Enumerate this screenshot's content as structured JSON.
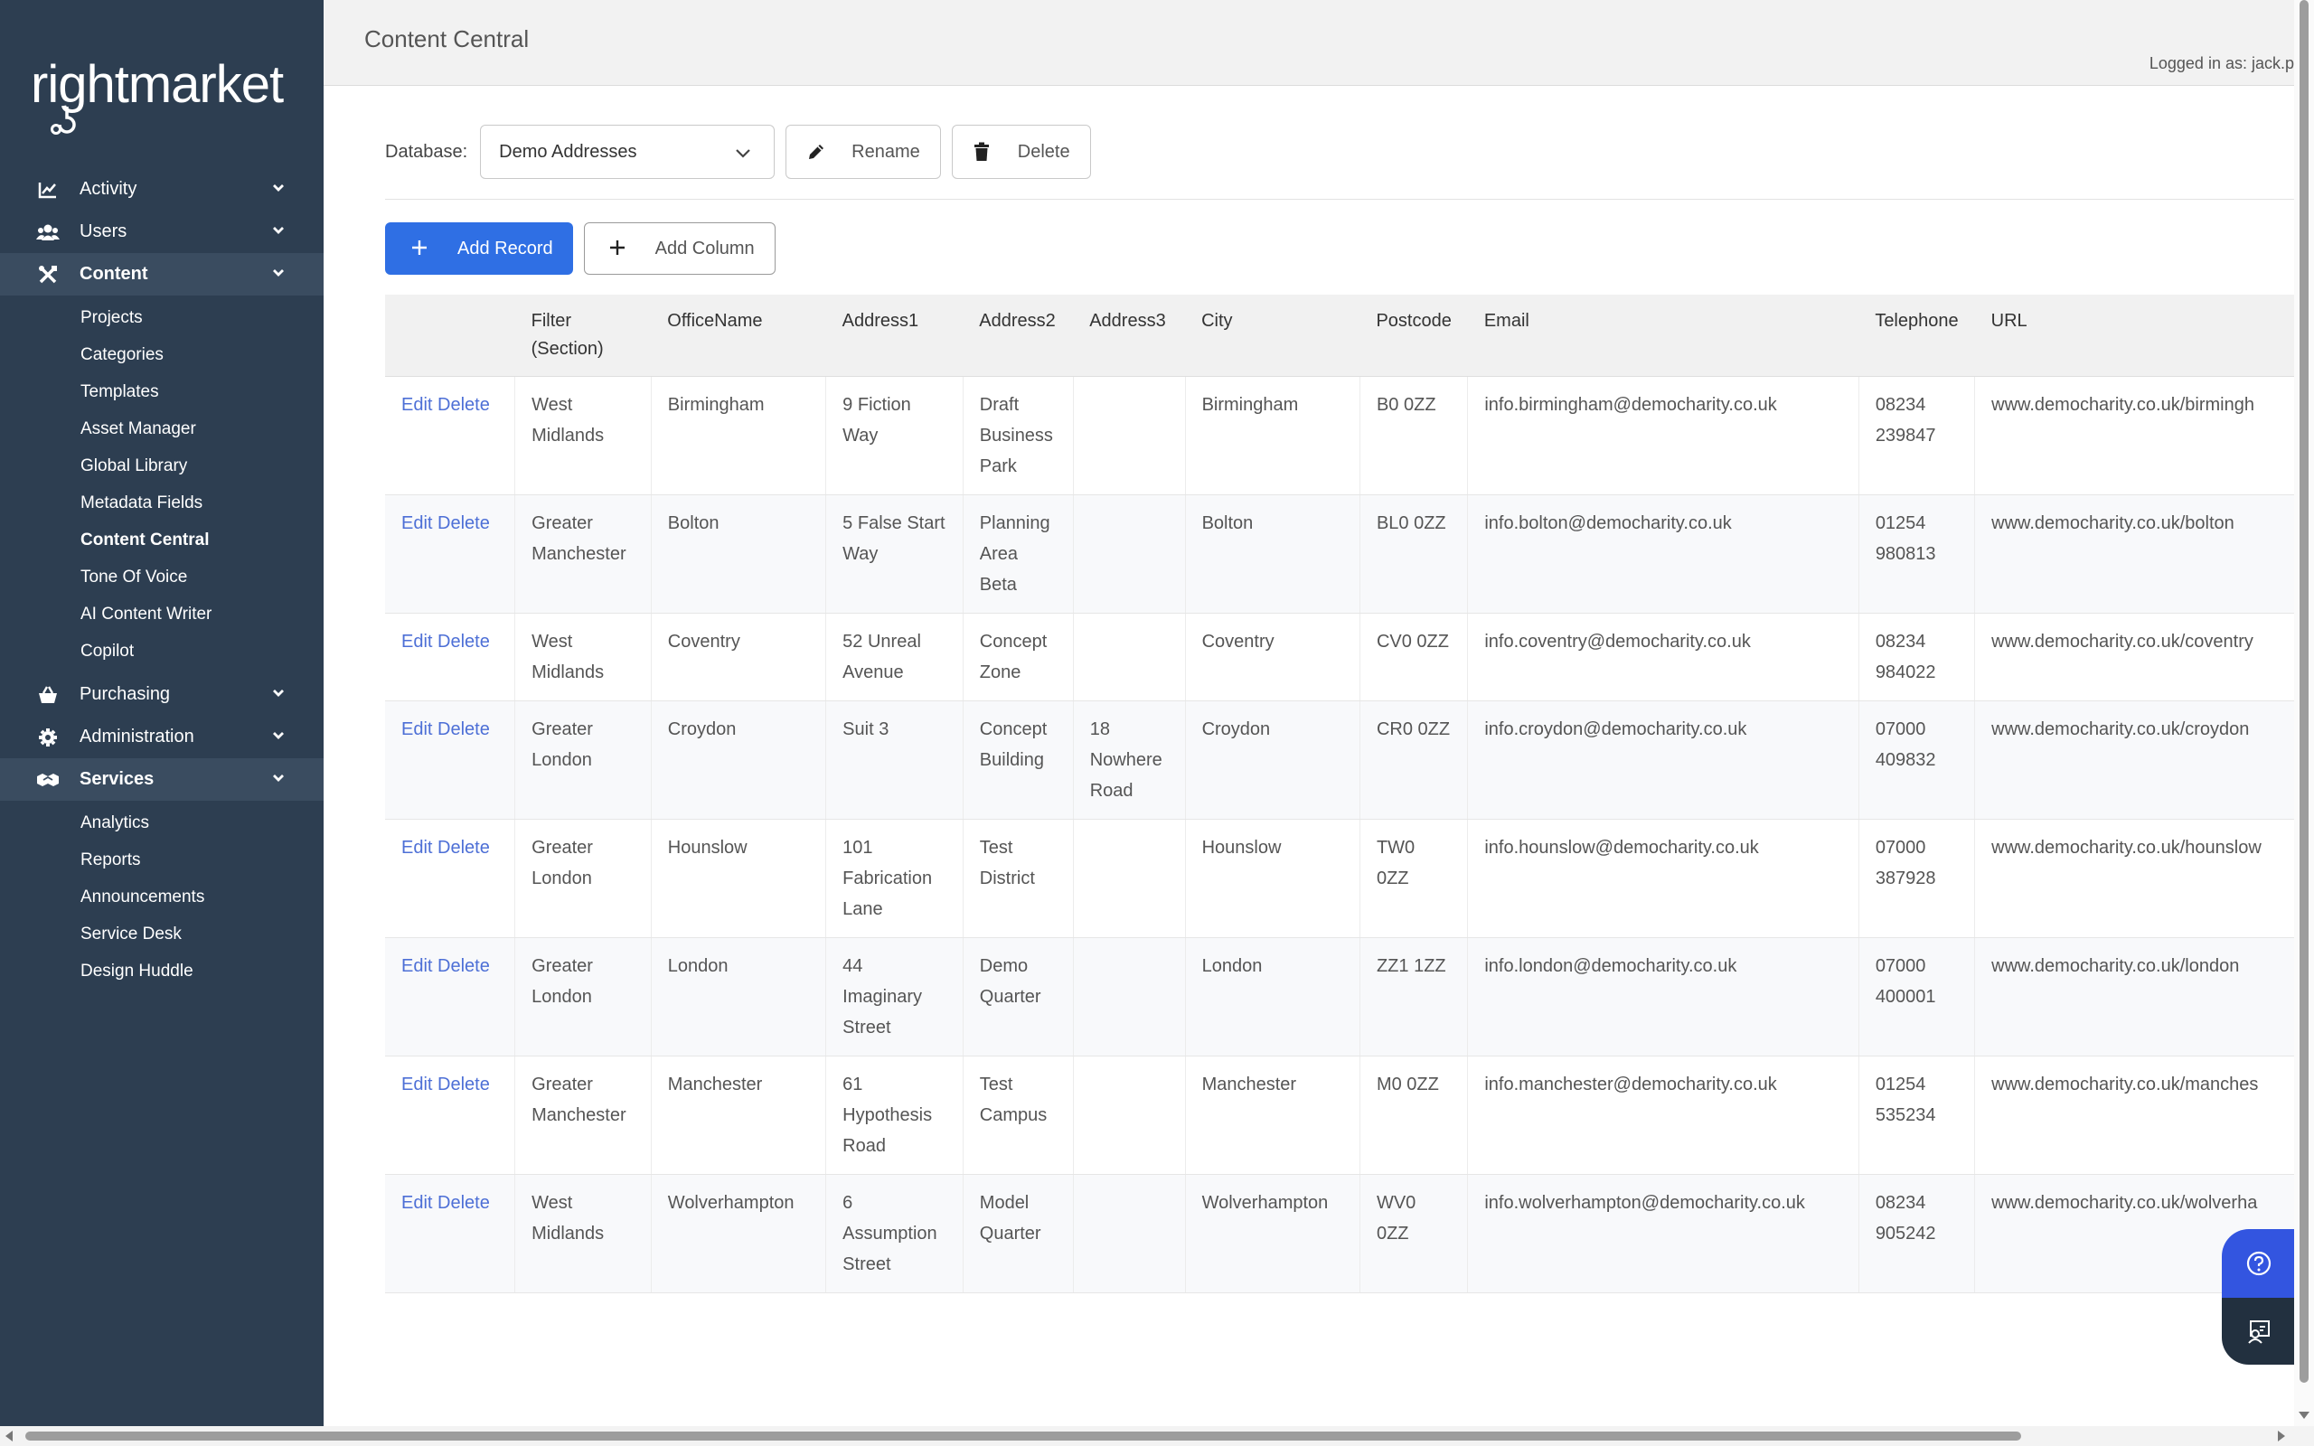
{
  "app": {
    "logo_text": "rightmarket"
  },
  "header": {
    "title": "Content Central",
    "logged_in": "Logged in as: jack.p"
  },
  "sidebar": {
    "items": [
      {
        "label": "Activity",
        "icon": "chart-line-icon"
      },
      {
        "label": "Users",
        "icon": "users-icon"
      },
      {
        "label": "Content",
        "icon": "tools-icon",
        "children": [
          "Projects",
          "Categories",
          "Templates",
          "Asset Manager",
          "Global Library",
          "Metadata Fields",
          "Content Central",
          "Tone Of Voice",
          "AI Content Writer",
          "Copilot"
        ]
      },
      {
        "label": "Purchasing",
        "icon": "basket-icon"
      },
      {
        "label": "Administration",
        "icon": "gear-icon"
      },
      {
        "label": "Services",
        "icon": "handshake-icon",
        "children": [
          "Analytics",
          "Reports",
          "Announcements",
          "Service Desk",
          "Design Huddle"
        ]
      }
    ]
  },
  "toolbar": {
    "database_label": "Database:",
    "database_value": "Demo Addresses",
    "rename_label": "Rename",
    "delete_label": "Delete",
    "add_record_label": "Add Record",
    "add_column_label": "Add Column"
  },
  "table": {
    "columns": [
      "",
      "Filter (Section)",
      "OfficeName",
      "Address1",
      "Address2",
      "Address3",
      "City",
      "Postcode",
      "Email",
      "Telephone",
      "URL"
    ],
    "edit_label": "Edit",
    "delete_label": "Delete",
    "rows": [
      [
        "West Midlands",
        "Birmingham",
        "9 Fiction Way",
        "Draft Business Park",
        "",
        "Birmingham",
        "B0 0ZZ",
        "info.birmingham@democharity.co.uk",
        "08234 239847",
        "www.democharity.co.uk/birmingh"
      ],
      [
        "Greater Manchester",
        "Bolton",
        "5 False Start Way",
        "Planning Area Beta",
        "",
        "Bolton",
        "BL0 0ZZ",
        "info.bolton@democharity.co.uk",
        "01254 980813",
        "www.democharity.co.uk/bolton"
      ],
      [
        "West Midlands",
        "Coventry",
        "52 Unreal Avenue",
        "Concept Zone",
        "",
        "Coventry",
        "CV0 0ZZ",
        "info.coventry@democharity.co.uk",
        "08234 984022",
        "www.democharity.co.uk/coventry"
      ],
      [
        "Greater London",
        "Croydon",
        "Suit 3",
        "Concept Building",
        "18 Nowhere Road",
        "Croydon",
        "CR0 0ZZ",
        "info.croydon@democharity.co.uk",
        "07000 409832",
        "www.democharity.co.uk/croydon"
      ],
      [
        "Greater London",
        "Hounslow",
        "101 Fabrication Lane",
        "Test District",
        "",
        "Hounslow",
        "TW0 0ZZ",
        "info.hounslow@democharity.co.uk",
        "07000 387928",
        "www.democharity.co.uk/hounslow"
      ],
      [
        "Greater London",
        "London",
        "44 Imaginary Street",
        "Demo Quarter",
        "",
        "London",
        "ZZ1 1ZZ",
        "info.london@democharity.co.uk",
        "07000 400001",
        "www.democharity.co.uk/london"
      ],
      [
        "Greater Manchester",
        "Manchester",
        "61 Hypothesis Road",
        "Test Campus",
        "",
        "Manchester",
        "M0 0ZZ",
        "info.manchester@democharity.co.uk",
        "01254 535234",
        "www.democharity.co.uk/manches"
      ],
      [
        "West Midlands",
        "Wolverhampton",
        "6 Assumption Street",
        "Model Quarter",
        "",
        "Wolverhampton",
        "WV0 0ZZ",
        "info.wolverhampton@democharity.co.uk",
        "08234 905242",
        "www.democharity.co.uk/wolverha"
      ]
    ]
  },
  "colors": {
    "sidebar": "#2d3e51",
    "primary": "#2f6fe4",
    "link": "#4d6fd6",
    "help_widget": "#3355e0"
  }
}
